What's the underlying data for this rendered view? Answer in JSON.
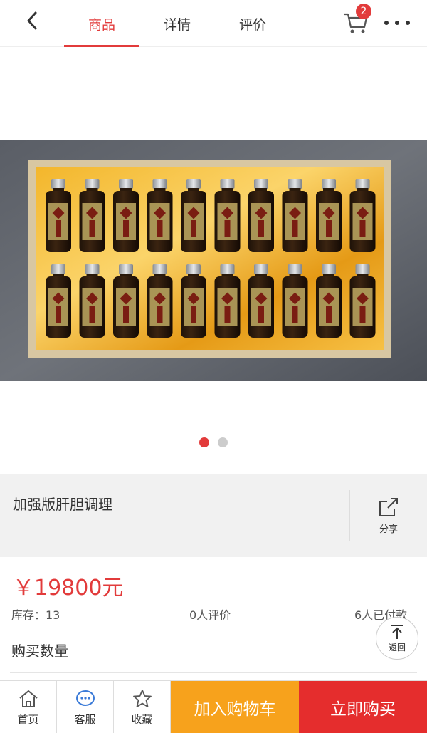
{
  "header": {
    "tabs": [
      {
        "label": "商品",
        "active": true
      },
      {
        "label": "详情",
        "active": false
      },
      {
        "label": "评价",
        "active": false
      }
    ],
    "cart_count": "2",
    "accent_color": "#e23b3b"
  },
  "gallery": {
    "dots": 2,
    "active_dot": 1
  },
  "product": {
    "title": "加强版肝胆调理",
    "share_label": "分享",
    "price": "￥19800元",
    "stock": "库存：13",
    "reviews": "0人评价",
    "paid": "6人已付款",
    "quantity_label": "购买数量"
  },
  "back_top_label": "返回",
  "bottom_bar": {
    "home": "首页",
    "service": "客服",
    "favorite": "收藏",
    "add_to_cart": "加入购物车",
    "buy_now": "立即购买",
    "add_color": "#f7a21c",
    "buy_color": "#e52d2d"
  }
}
